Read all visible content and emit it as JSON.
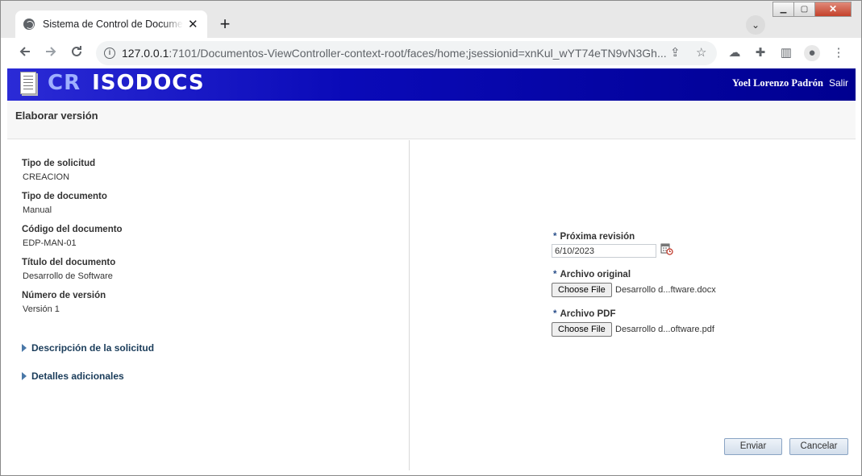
{
  "browser": {
    "tab_title": "Sistema de Control de Documentos",
    "url_host": "127.0.0.1",
    "url_port": ":7101",
    "url_path": "/Documentos-ViewController-context-root/faces/home;jsessionid=xnKul_wYT74eTN9vN3Gh..."
  },
  "banner": {
    "logo_prefix": "CR",
    "logo_name": "ISODOCS",
    "user_name": "Yoel Lorenzo Padrón",
    "logout_label": "Salir"
  },
  "page": {
    "title": "Elaborar versión"
  },
  "details": {
    "fields": [
      {
        "label": "Tipo de solicitud",
        "value": "CREACION"
      },
      {
        "label": "Tipo de documento",
        "value": "Manual"
      },
      {
        "label": "Código del documento",
        "value": "EDP-MAN-01"
      },
      {
        "label": "Título del documento",
        "value": "Desarrollo de Software"
      },
      {
        "label": "Número de versión",
        "value": "Versión 1"
      }
    ],
    "sections": [
      {
        "label": "Descripción de la solicitud"
      },
      {
        "label": "Detalles adicionales"
      }
    ]
  },
  "form": {
    "required_mark": "*",
    "next_review_label": "Próxima revisión",
    "next_review_value": "6/10/2023",
    "original_file_label": "Archivo original",
    "original_file_button": "Choose File",
    "original_file_name": "Desarrollo d...ftware.docx",
    "pdf_file_label": "Archivo PDF",
    "pdf_file_button": "Choose File",
    "pdf_file_name": "Desarrollo d...oftware.pdf",
    "submit_label": "Enviar",
    "cancel_label": "Cancelar"
  }
}
